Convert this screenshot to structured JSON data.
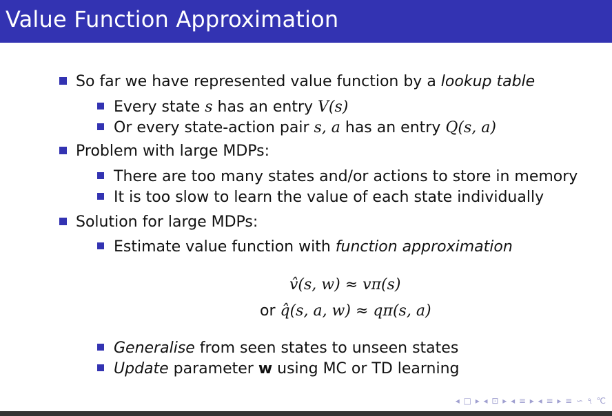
{
  "slide": {
    "title": "Value Function Approximation",
    "bullets": [
      {
        "text_before": "So far we have represented value function by a ",
        "text_em": "lookup table",
        "sub": [
          {
            "t1": "Every state ",
            "m1": "s",
            "t2": " has an entry ",
            "m2": "V(s)"
          },
          {
            "t1": "Or every state-action pair ",
            "m1": "s, a",
            "t2": " has an entry ",
            "m2": "Q(s, a)"
          }
        ]
      },
      {
        "text": "Problem with large MDPs:",
        "sub": [
          "There are too many states and/or actions to store in memory",
          "It is too slow to learn the value of each state individually"
        ]
      },
      {
        "text": "Solution for large MDPs:",
        "sub_approx": {
          "t1": "Estimate value function with ",
          "em": "function approximation"
        },
        "equations": {
          "eq1": {
            "lhs": "v̂(s, w)",
            "rel": "≈",
            "rhs": "vπ(s)"
          },
          "eq2": {
            "prefix": "or",
            "lhs": "q̂(s, a, w)",
            "rel": "≈",
            "rhs": "qπ(s, a)"
          }
        },
        "sub_after": [
          {
            "em": "Generalise",
            "rest": " from seen states to unseen states"
          },
          {
            "em": "Update",
            "mid": " parameter ",
            "bold": "w",
            "rest": " using MC or TD learning"
          }
        ]
      }
    ]
  },
  "nav": {
    "symbols": "◂ □ ▸ ◂ ⊡ ▸ ◂ ≡ ▸ ◂ ≡ ▸  ≡  ∽ ৭ ℃"
  },
  "colors": {
    "title_bar": "#3333b2",
    "bullet": "#3333b2",
    "bottom_bar": "#333333"
  }
}
